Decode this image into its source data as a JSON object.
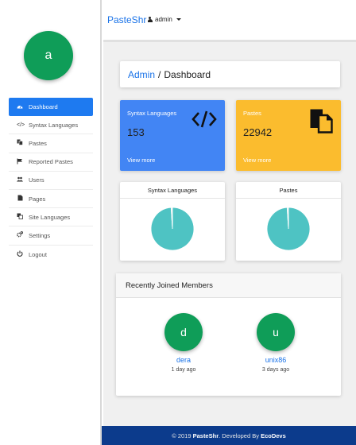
{
  "brand": "PasteShr",
  "user_menu": {
    "label": "admin"
  },
  "profile": {
    "initial": "a"
  },
  "sidebar": {
    "items": [
      {
        "label": "Dashboard",
        "icon": "dashboard-icon",
        "active": true
      },
      {
        "label": "Syntax Languages",
        "icon": "code-icon"
      },
      {
        "label": "Pastes",
        "icon": "copy-icon"
      },
      {
        "label": "Reported Pastes",
        "icon": "flag-icon"
      },
      {
        "label": "Users",
        "icon": "users-icon"
      },
      {
        "label": "Pages",
        "icon": "file-icon"
      },
      {
        "label": "Site Languages",
        "icon": "language-icon"
      },
      {
        "label": "Settings",
        "icon": "cogs-icon"
      },
      {
        "label": "Logout",
        "icon": "power-icon"
      }
    ]
  },
  "breadcrumb": {
    "root": "Admin",
    "separator": "/",
    "current": "Dashboard"
  },
  "stats": [
    {
      "title": "Syntax Languages",
      "value": "153",
      "link": "View more",
      "icon": "code-icon",
      "color": "#4285f4"
    },
    {
      "title": "Pastes",
      "value": "22942",
      "link": "View more",
      "icon": "copy-icon",
      "color": "#fbbc2e"
    }
  ],
  "charts": [
    {
      "title": "Syntax Languages"
    },
    {
      "title": "Pastes"
    }
  ],
  "chart_data": [
    {
      "type": "pie",
      "values": [
        99,
        1
      ],
      "colors": [
        "#4ec3c3",
        "#e8e8e8"
      ]
    },
    {
      "type": "pie",
      "values": [
        99,
        1
      ],
      "colors": [
        "#4ec3c3",
        "#e8e8e8"
      ]
    }
  ],
  "members": {
    "title": "Recently Joined Members",
    "list": [
      {
        "initial": "d",
        "name": "dera",
        "joined": "1 day ago"
      },
      {
        "initial": "u",
        "name": "unix86",
        "joined": "3 days ago"
      }
    ]
  },
  "footer": {
    "prefix": "© 2019",
    "brand": "PasteShr",
    "middle": ". Developed By",
    "dev": "EcoDevs"
  },
  "colors": {
    "accent": "#1e7af0",
    "avatar": "#0f9d58",
    "footer": "#0c3b8c",
    "pie": "#4ec3c3"
  }
}
